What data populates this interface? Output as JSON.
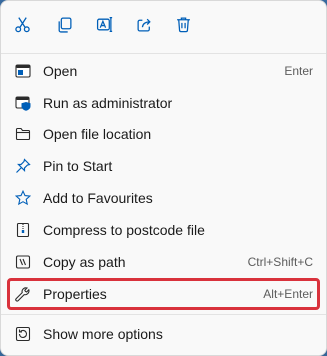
{
  "colors": {
    "accent": "#005fb8",
    "highlight_border": "#d9323c",
    "menu_background": "#f9f9f9"
  },
  "toolbar": {
    "buttons": [
      {
        "name": "cut",
        "icon": "scissors-icon"
      },
      {
        "name": "copy",
        "icon": "copy-icon"
      },
      {
        "name": "rename",
        "icon": "rename-icon"
      },
      {
        "name": "share",
        "icon": "share-icon"
      },
      {
        "name": "delete",
        "icon": "trash-icon"
      }
    ]
  },
  "menu": {
    "items": [
      {
        "label": "Open",
        "shortcut": "Enter",
        "icon": "open-window-icon"
      },
      {
        "label": "Run as administrator",
        "shortcut": "",
        "icon": "shield-icon"
      },
      {
        "label": "Open file location",
        "shortcut": "",
        "icon": "folder-icon"
      },
      {
        "label": "Pin to Start",
        "shortcut": "",
        "icon": "pin-icon"
      },
      {
        "label": "Add to Favourites",
        "shortcut": "",
        "icon": "star-icon"
      },
      {
        "label": "Compress to postcode file",
        "shortcut": "",
        "icon": "zip-file-icon"
      },
      {
        "label": "Copy as path",
        "shortcut": "Ctrl+Shift+C",
        "icon": "copy-path-icon"
      },
      {
        "label": "Properties",
        "shortcut": "Alt+Enter",
        "icon": "wrench-icon",
        "highlighted": true
      },
      {
        "label": "Show more options",
        "shortcut": "",
        "icon": "more-options-icon"
      }
    ]
  }
}
